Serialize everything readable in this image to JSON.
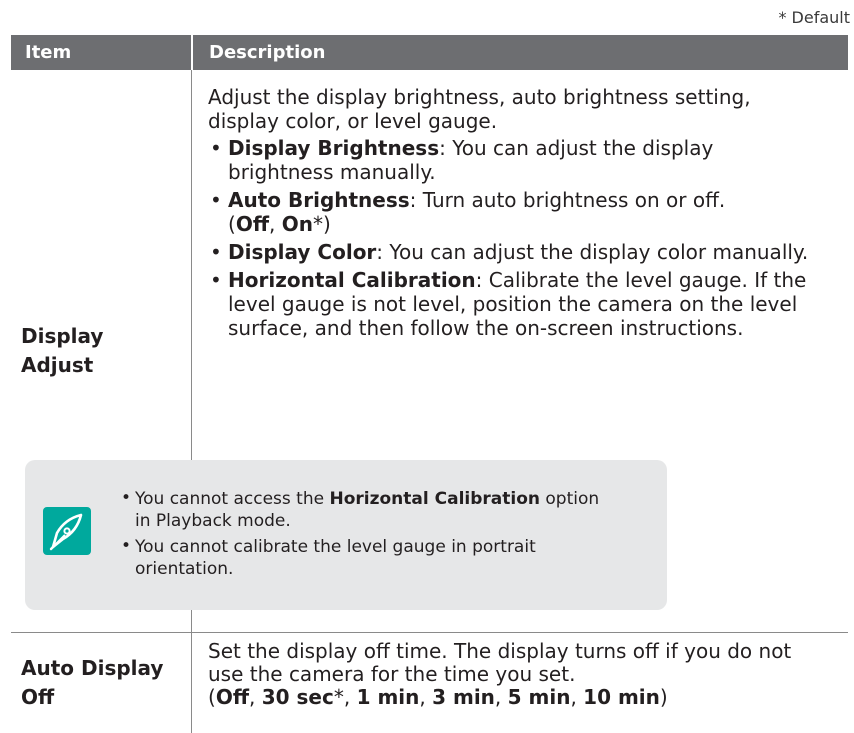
{
  "default_note": "* Default",
  "header": {
    "item": "Item",
    "description": "Description"
  },
  "rows": [
    {
      "item_line1": "Display",
      "item_line2": "Adjust",
      "intro_line1": "Adjust the display brightness, auto brightness setting,",
      "intro_line2": "display color, or level gauge.",
      "bullets": [
        {
          "term": "Display Brightness",
          "text_line1": ": You can adjust the display",
          "text_line2": "brightness manually."
        },
        {
          "term": "Auto Brightness",
          "text_line1": ": Turn auto brightness on or off.",
          "opt_a": "Off",
          "opt_b": "On",
          "opt_b_suffix": "*"
        },
        {
          "term": "Display Color",
          "text_line1": ": You can adjust the display color manually."
        },
        {
          "term": "Horizontal Calibration",
          "text_line1": ": Calibrate the level gauge. If the",
          "text_line2": "level gauge is not level, position the camera on the level",
          "text_line3": "surface, and then follow the on-screen instructions."
        }
      ],
      "note": {
        "items": [
          {
            "pre": "You cannot access the ",
            "bold": "Horizontal Calibration",
            "post": " option",
            "line2": "in Playback mode."
          },
          {
            "pre": "You cannot calibrate the level gauge in portrait",
            "line2": "orientation."
          }
        ]
      }
    },
    {
      "item_line1": "Auto Display",
      "item_line2": "Off",
      "desc_line1": "Set the display off time. The display turns off if you do not",
      "desc_line2": "use the camera for the time you set.",
      "options": [
        "Off",
        "30 sec",
        "1 min",
        "3 min",
        "5 min",
        "10 min"
      ],
      "default_mark": "*"
    }
  ],
  "colors": {
    "header_bg": "#6d6e71",
    "note_bg": "#e6e7e8",
    "icon_teal": "#00a99d"
  },
  "icons": {
    "note": "pen-nib-icon"
  }
}
